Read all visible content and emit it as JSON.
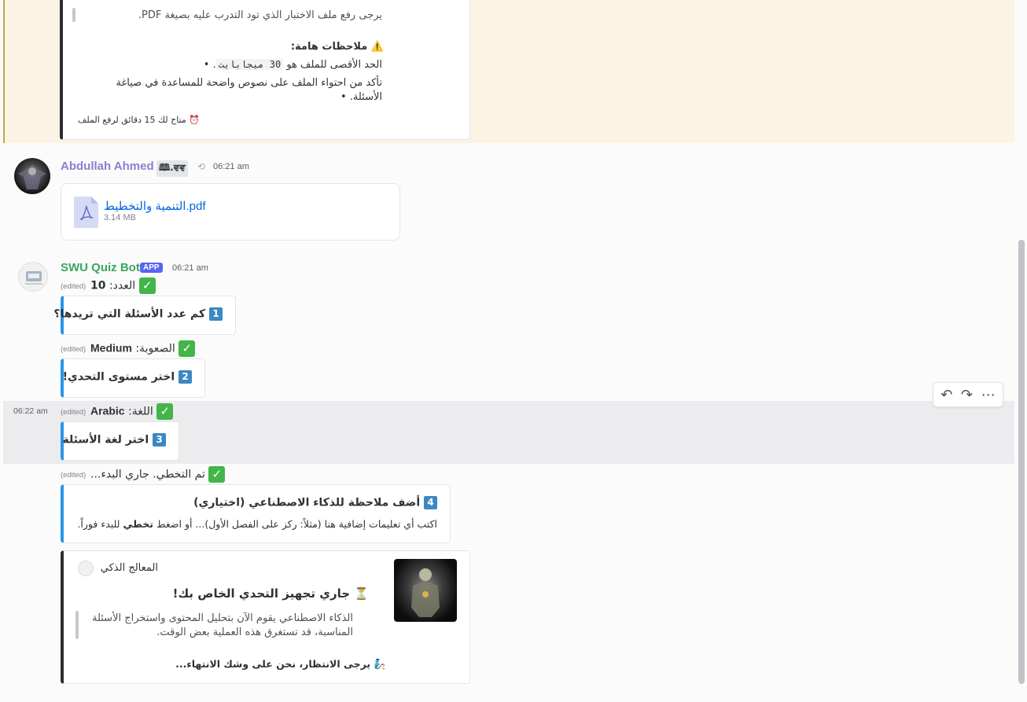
{
  "top_embed": {
    "quote_text": "يرجى رفع ملف الاختبار الذي تود التدرب عليه بصيغة PDF.",
    "notes_title": "⚠️ ملاحظات هامة:",
    "bullet1_prefix": "الحد الأقصى للملف هو",
    "bullet1_code": "30 ميجابايت",
    "bullet1_suffix": ".",
    "bullet2": "تأكد من احتواء الملف على نصوص واضحة للمساعدة في صياغة الأسئلة.",
    "timer": "⏰ متاح لك 15 دقائق لرفع الملف"
  },
  "msg_user": {
    "name": "Abdullah Ahmed",
    "tag": "🕮.ਵਵ",
    "time": "06:21 am",
    "file_name": "التنمية والتخطيط.pdf",
    "file_size": "3.14 MB"
  },
  "msg_bot": {
    "name": "SWU Quiz Bot",
    "app_badge": "APP",
    "time": "06:21 am",
    "edited": "(edited)",
    "count_label": "العدد:",
    "count_value": "10",
    "q1_num": "1",
    "q1_title": "كم عدد الأسئلة التي تريدها؟",
    "difficulty_label": "الصعوبة:",
    "difficulty_value": "Medium",
    "q2_num": "2",
    "q2_title": "اختر مستوى التحدي!",
    "hover_time": "06:22 am",
    "language_label": "اللغة:",
    "language_value": "Arabic",
    "q3_num": "3",
    "q3_title": "اختر لغة الأسئلة",
    "skip_status": "تم التخطي. جاري البدء...",
    "q4_num": "4",
    "q4_title": "أضف ملاحظة للذكاء الاصطناعي (اختياري)",
    "q4_desc_prefix": "اكتب أي تعليمات إضافية هنا (مثلاً: ركز على الفصل الأول)... أو اضغط",
    "q4_desc_bold": "تخطي",
    "q4_desc_suffix": "للبدء فوراً."
  },
  "processing_embed": {
    "author": "المعالج الذكي",
    "title": "⏳ جاري تجهيز التحدي الخاص بك!",
    "quote": "الذكاء الاصطناعي يقوم الآن بتحليل المحتوى واستخراج الأسئلة المناسبة، قد تستغرق هذه العملية بعض الوقت.",
    "footer": "🧞 يرجى الانتظار، نحن على وشك الانتهاء..."
  },
  "colors": {
    "user_name": "#8b7ed1",
    "bot_name": "#3ba55d",
    "accent_blue": "#2a95e8",
    "highlight_bg": "#fbf3e4"
  },
  "icons": {
    "reply": "reply-icon",
    "forward": "forward-icon",
    "more": "more-icon",
    "pdf": "pdf-file-icon"
  }
}
